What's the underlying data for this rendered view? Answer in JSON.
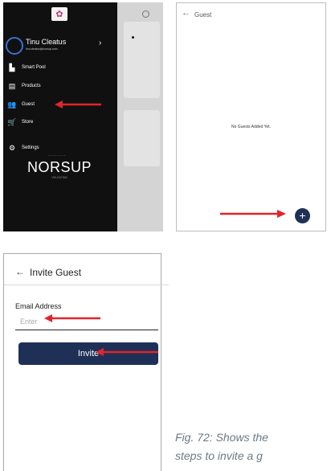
{
  "drawer": {
    "user_name": "Tinu Cleatus",
    "user_email": "tinu.cleatus@norsup.com",
    "menu": [
      {
        "label": "Smart Pool",
        "icon": "pool-icon"
      },
      {
        "label": "Products",
        "icon": "products-icon"
      },
      {
        "label": "Guest",
        "icon": "guest-icon"
      },
      {
        "label": "Store",
        "icon": "cart-icon"
      },
      {
        "label": "Settings",
        "icon": "gear-icon"
      }
    ],
    "brand": "NORSUP",
    "brand_sub": "VELOCITAS"
  },
  "guest_screen": {
    "title": "Guest",
    "empty_text": "No Guests Added Yet."
  },
  "invite_screen": {
    "title": "Invite Guest",
    "field_label": "Email Address",
    "field_placeholder": "Enter",
    "button_label": "Invite"
  },
  "caption": {
    "line1": "Fig. 72: Shows the",
    "line2": "steps to invite a g"
  },
  "colors": {
    "drawer_bg": "#101010",
    "accent": "#1f3057",
    "arrow": "#e0252b"
  }
}
